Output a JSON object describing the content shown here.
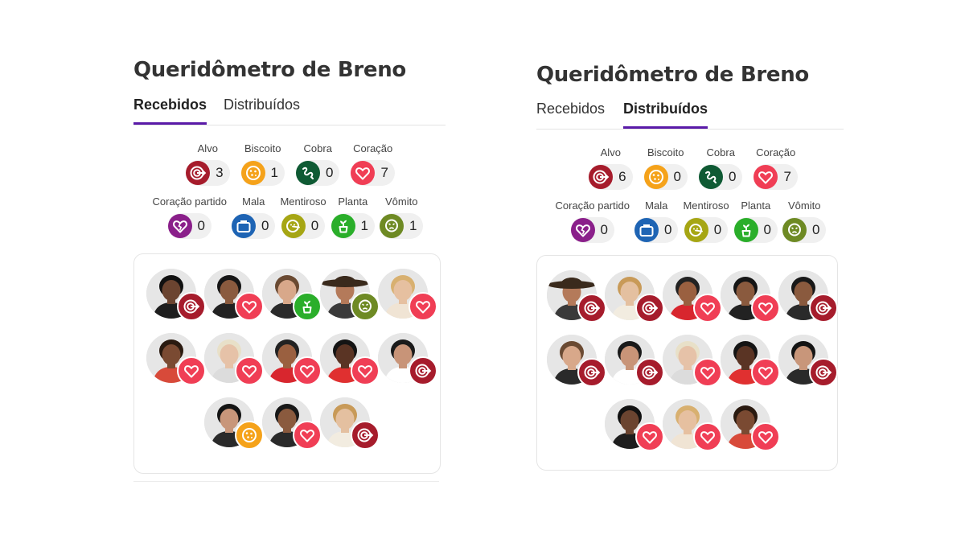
{
  "colors": {
    "accent": "#5a1aa8",
    "alvo": "#a61c2c",
    "biscoito": "#f5a21a",
    "cobra": "#0f5a34",
    "coracao": "#f03e55",
    "coracao_partido": "#8a1f8a",
    "mala": "#1e64b4",
    "mentiroso": "#a6a614",
    "planta": "#2aae2a",
    "vomito": "#6e8a24"
  },
  "panels": [
    {
      "title": "Queridômetro de Breno",
      "tabs": [
        {
          "label": "Recebidos",
          "active": true
        },
        {
          "label": "Distribuídos",
          "active": false
        }
      ],
      "counts_row1": [
        {
          "label": "Alvo",
          "icon": "alvo-icon",
          "type": "alvo",
          "count": "3"
        },
        {
          "label": "Biscoito",
          "icon": "biscoito-icon",
          "type": "biscoito",
          "count": "1"
        },
        {
          "label": "Cobra",
          "icon": "cobra-icon",
          "type": "cobra",
          "count": "0"
        },
        {
          "label": "Coração",
          "icon": "coracao-icon",
          "type": "coracao",
          "count": "7"
        }
      ],
      "counts_row2": [
        {
          "label": "Coração partido",
          "icon": "coracao-partido-icon",
          "type": "coracao_partido",
          "count": "0"
        },
        {
          "label": "Mala",
          "icon": "mala-icon",
          "type": "mala",
          "count": "0"
        },
        {
          "label": "Mentiroso",
          "icon": "mentiroso-icon",
          "type": "mentiroso",
          "count": "0"
        },
        {
          "label": "Planta",
          "icon": "planta-icon",
          "type": "planta",
          "count": "1"
        },
        {
          "label": "Vômito",
          "icon": "vomito-icon",
          "type": "vomito",
          "count": "1"
        }
      ],
      "avatar_rows": [
        [
          {
            "badge": "alvo",
            "look": {
              "skin": "#6b4430",
              "hair": "#111111",
              "shirt": "#1e1e1e"
            }
          },
          {
            "badge": "coracao",
            "look": {
              "skin": "#8a5a3e",
              "hair": "#151515",
              "shirt": "#222222"
            }
          },
          {
            "badge": "planta",
            "look": {
              "skin": "#d8a88a",
              "hair": "#6a4a32",
              "shirt": "#2a2a2a"
            }
          },
          {
            "badge": "vomito",
            "look": {
              "skin": "#b47a5a",
              "hair": "#3a2414",
              "shirt": "#3a3a3a",
              "hat": true
            }
          },
          {
            "badge": "coracao",
            "look": {
              "skin": "#e6c0a0",
              "hair": "#d8b070",
              "shirt": "#f0e4d4"
            }
          }
        ],
        [
          {
            "badge": "coracao",
            "look": {
              "skin": "#7a4a32",
              "hair": "#2a1a10",
              "shirt": "#d84a3a"
            }
          },
          {
            "badge": "coracao",
            "look": {
              "skin": "#e6c2a8",
              "hair": "#e8e0c8",
              "shirt": "#dcdcdc"
            }
          },
          {
            "badge": "coracao",
            "look": {
              "skin": "#9a6040",
              "hair": "#222222",
              "shirt": "#d8262e"
            }
          },
          {
            "badge": "coracao",
            "look": {
              "skin": "#5a3424",
              "hair": "#141414",
              "shirt": "#e03030"
            }
          },
          {
            "badge": "alvo",
            "look": {
              "skin": "#c89478",
              "hair": "#1a1a1a",
              "shirt": "#ffffff"
            }
          }
        ],
        [
          {
            "badge": "biscoito",
            "look": {
              "skin": "#c8967a",
              "hair": "#141414",
              "shirt": "#2a2a2a"
            }
          },
          {
            "badge": "coracao",
            "look": {
              "skin": "#8a5a3e",
              "hair": "#181818",
              "shirt": "#2a2a2a"
            }
          },
          {
            "badge": "alvo",
            "look": {
              "skin": "#e4c0a0",
              "hair": "#c89a58",
              "shirt": "#f2ece0"
            }
          }
        ]
      ]
    },
    {
      "title": "Queridômetro de Breno",
      "tabs": [
        {
          "label": "Recebidos",
          "active": false
        },
        {
          "label": "Distribuídos",
          "active": true
        }
      ],
      "counts_row1": [
        {
          "label": "Alvo",
          "icon": "alvo-icon",
          "type": "alvo",
          "count": "6"
        },
        {
          "label": "Biscoito",
          "icon": "biscoito-icon",
          "type": "biscoito",
          "count": "0"
        },
        {
          "label": "Cobra",
          "icon": "cobra-icon",
          "type": "cobra",
          "count": "0"
        },
        {
          "label": "Coração",
          "icon": "coracao-icon",
          "type": "coracao",
          "count": "7"
        }
      ],
      "counts_row2": [
        {
          "label": "Coração partido",
          "icon": "coracao-partido-icon",
          "type": "coracao_partido",
          "count": "0"
        },
        {
          "label": "Mala",
          "icon": "mala-icon",
          "type": "mala",
          "count": "0"
        },
        {
          "label": "Mentiroso",
          "icon": "mentiroso-icon",
          "type": "mentiroso",
          "count": "0"
        },
        {
          "label": "Planta",
          "icon": "planta-icon",
          "type": "planta",
          "count": "0"
        },
        {
          "label": "Vômito",
          "icon": "vomito-icon",
          "type": "vomito",
          "count": "0"
        }
      ],
      "avatar_rows": [
        [
          {
            "badge": "alvo",
            "look": {
              "skin": "#b47a5a",
              "hair": "#3a2414",
              "shirt": "#3a3a3a",
              "hat": true
            }
          },
          {
            "badge": "alvo",
            "look": {
              "skin": "#e4c0a0",
              "hair": "#c89a58",
              "shirt": "#f2ece0"
            }
          },
          {
            "badge": "coracao",
            "look": {
              "skin": "#9a6040",
              "hair": "#222222",
              "shirt": "#d8262e"
            }
          },
          {
            "badge": "coracao",
            "look": {
              "skin": "#8a5a3e",
              "hair": "#151515",
              "shirt": "#222222"
            }
          },
          {
            "badge": "alvo",
            "look": {
              "skin": "#8a5a3e",
              "hair": "#181818",
              "shirt": "#2a2a2a"
            }
          }
        ],
        [
          {
            "badge": "alvo",
            "look": {
              "skin": "#d8a88a",
              "hair": "#6a4a32",
              "shirt": "#2a2a2a"
            }
          },
          {
            "badge": "alvo",
            "look": {
              "skin": "#c89478",
              "hair": "#1a1a1a",
              "shirt": "#ffffff"
            }
          },
          {
            "badge": "coracao",
            "look": {
              "skin": "#e6c2a8",
              "hair": "#e8e0c8",
              "shirt": "#dcdcdc"
            }
          },
          {
            "badge": "coracao",
            "look": {
              "skin": "#5a3424",
              "hair": "#141414",
              "shirt": "#e03030"
            }
          },
          {
            "badge": "alvo",
            "look": {
              "skin": "#c8967a",
              "hair": "#141414",
              "shirt": "#2a2a2a"
            }
          }
        ],
        [
          {
            "badge": "coracao",
            "look": {
              "skin": "#6b4430",
              "hair": "#111111",
              "shirt": "#1e1e1e"
            }
          },
          {
            "badge": "coracao",
            "look": {
              "skin": "#e6c0a0",
              "hair": "#d8b070",
              "shirt": "#f0e4d4"
            }
          },
          {
            "badge": "coracao",
            "look": {
              "skin": "#7a4a32",
              "hair": "#2a1a10",
              "shirt": "#d84a3a"
            }
          }
        ]
      ]
    }
  ]
}
